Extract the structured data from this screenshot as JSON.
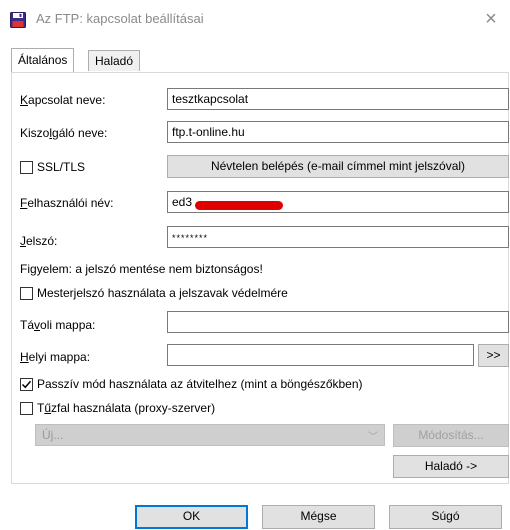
{
  "window": {
    "title": "Az FTP: kapcsolat beállításai",
    "close_icon": "×"
  },
  "tabs": [
    {
      "label": "Általános",
      "active": true
    },
    {
      "label": "Haladó",
      "active": false
    }
  ],
  "fields": {
    "connection_name": {
      "label_pre": "",
      "label_u": "K",
      "label_post": "apcsolat neve:",
      "value": "tesztkapcsolat"
    },
    "server_name": {
      "label_pre": "Kiszo",
      "label_u": "l",
      "label_post": "gáló neve:",
      "value": "ftp.t-online.hu"
    },
    "username": {
      "label_pre": "",
      "label_u": "F",
      "label_post": "elhasználói név:",
      "value": "ed3"
    },
    "password": {
      "label_pre": "",
      "label_u": "J",
      "label_post": "elszó:",
      "value": "********"
    },
    "remote_folder": {
      "label_pre": "Tá",
      "label_u": "v",
      "label_post": "oli mappa:",
      "value": ""
    },
    "local_folder": {
      "label_pre": "",
      "label_u": "H",
      "label_post": "elyi mappa:",
      "value": ""
    }
  },
  "ssl": {
    "label": "SSL/TLS",
    "checked": false
  },
  "anonymous_button": "Névtelen belépés (e-mail címmel mint jelszóval)",
  "warning": "Figyelem: a jelszó mentése nem biztonságos!",
  "master_password": {
    "label": "Mesterjelszó használata a jelszavak védelmére",
    "checked": false
  },
  "browse_button": ">>",
  "passive_mode": {
    "label": "Passzív mód használata az átvitelhez (mint a böngészőkben)",
    "checked": true
  },
  "firewall": {
    "label_pre": "T",
    "label_u": "ű",
    "label_post": "zfal használata (proxy-szerver)",
    "checked": false
  },
  "proxy_combo": {
    "value": "Új...",
    "arrow": "﹀"
  },
  "modify_button": "Módosítás...",
  "advanced_button": "Haladó ->",
  "footer": {
    "ok": "OK",
    "cancel": "Mégse",
    "help": "Súgó"
  },
  "colors": {
    "accent": "#0078d7",
    "redaction": "#e00000",
    "checkmark": "#000000"
  }
}
